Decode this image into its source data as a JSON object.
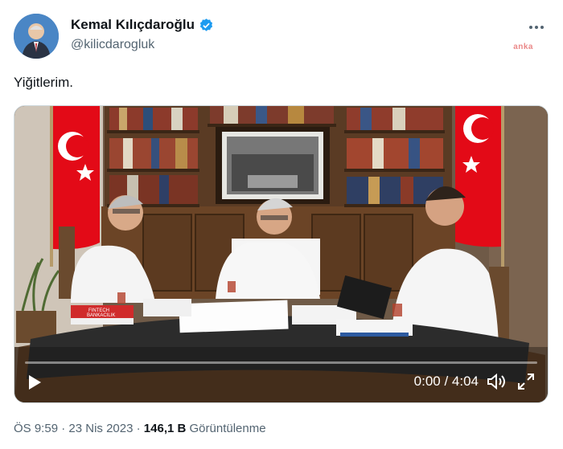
{
  "author": {
    "name": "Kemal Kılıçdaroğlu",
    "handle": "@kilicdarogluk",
    "verified_icon": "verified-badge-icon"
  },
  "more_icon": "more-options-icon",
  "watermark": "anka",
  "tweet": {
    "text": "Yiğitlerim."
  },
  "video": {
    "book_cover_text": "FINTECH\nBANKACILIK",
    "time": "0:00 / 4:04",
    "progress": 0,
    "play_icon": "play-icon",
    "volume_icon": "volume-icon",
    "fullscreen_icon": "fullscreen-icon"
  },
  "meta": {
    "time": "ÖS 9:59",
    "date": "23 Nis 2023",
    "separator": "·",
    "views_count": "146,1 B",
    "views_label": "Görüntülenme"
  },
  "colors": {
    "flag_red": "#e30a17",
    "verified_blue": "#1d9bf0"
  }
}
